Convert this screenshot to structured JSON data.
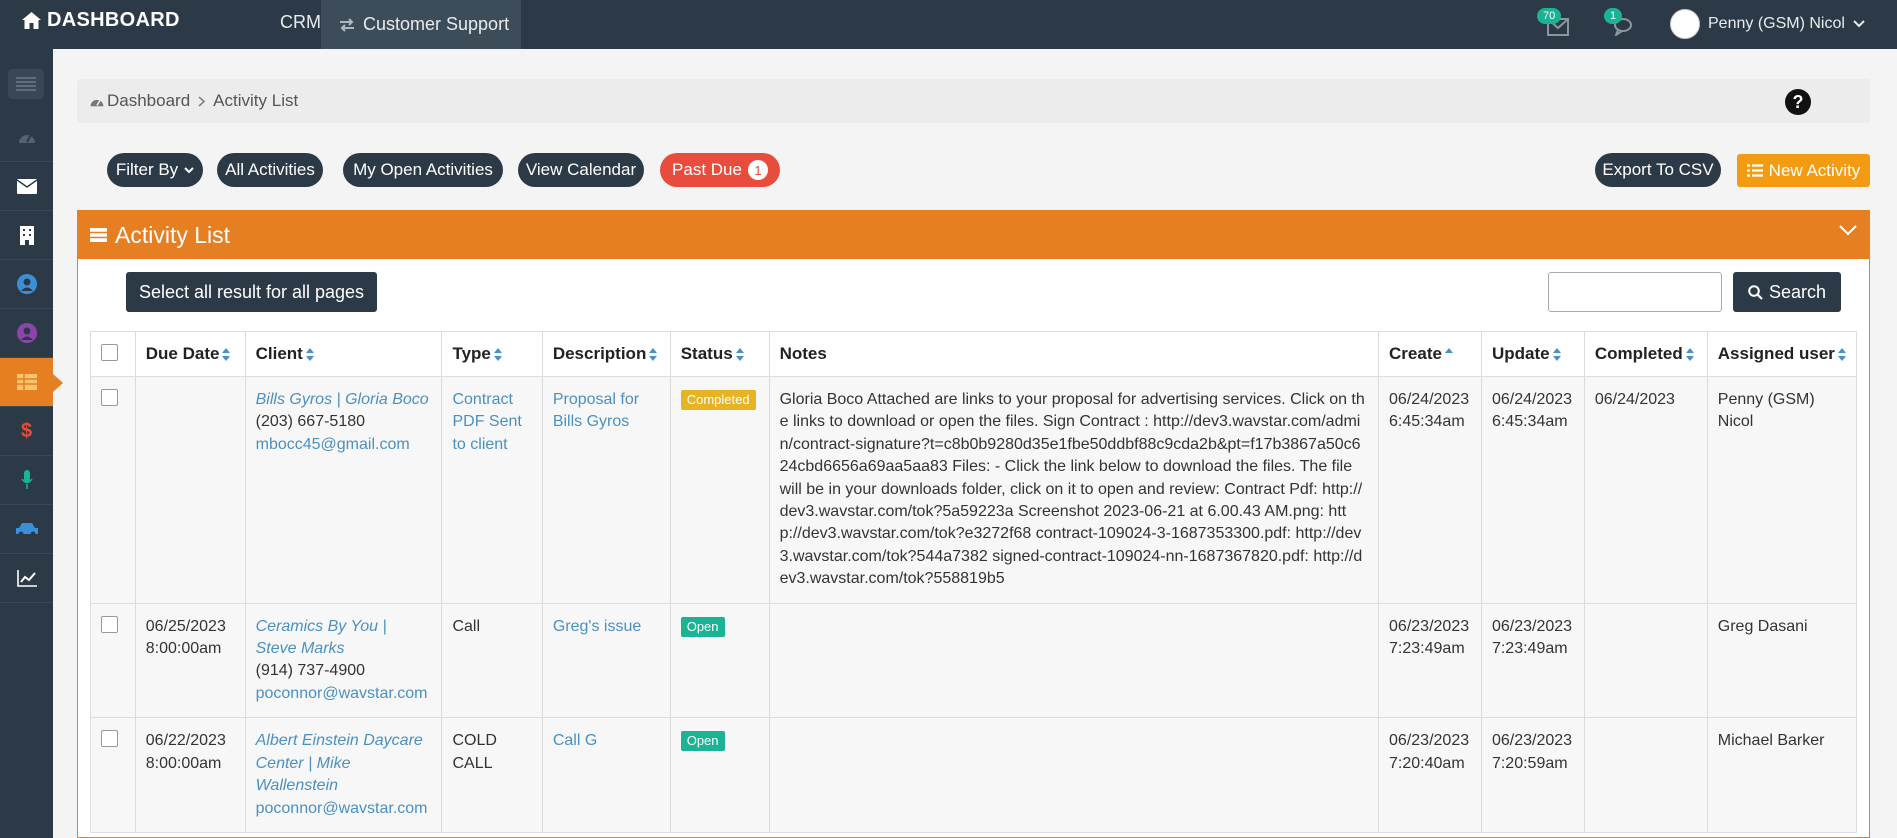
{
  "topbar": {
    "brand": "DASHBOARD",
    "nav_crm": "CRM",
    "nav_customer_support": "Customer Support",
    "mail_count": "70",
    "chat_count": "1",
    "user_name": "Penny (GSM) Nicol"
  },
  "breadcrumb": {
    "home": "Dashboard",
    "current": "Activity List"
  },
  "help_label": "?",
  "filters": {
    "filter_by": "Filter By",
    "all_activities": "All Activities",
    "my_open_activities": "My Open Activities",
    "view_calendar": "View Calendar",
    "past_due": "Past Due",
    "past_due_count": "1"
  },
  "actions": {
    "export_csv": "Export To CSV",
    "new_activity": "New Activity"
  },
  "panel": {
    "title": "Activity List",
    "select_all": "Select all result for all pages",
    "search_value": "",
    "search_button": "Search"
  },
  "table": {
    "headers": {
      "due_date": "Due Date",
      "client": "Client",
      "type": "Type",
      "description": "Description",
      "status": "Status",
      "notes": "Notes",
      "create": "Create",
      "update": "Update",
      "completed": "Completed",
      "assigned_user": "Assigned user"
    },
    "rows": [
      {
        "due_date": "",
        "due_time": "",
        "client_name": "Bills Gyros | Gloria Boco",
        "client_phone": "(203) 667-5180",
        "client_email": "mbocc45@gmail.com",
        "type": "Contract PDF Sent to client",
        "description": "Proposal for Bills Gyros",
        "status": "Completed",
        "notes": "Gloria Boco Attached are links to your proposal for advertising services. Click on the links to download or open the files. Sign Contract : http://dev3.wavstar.com/admin/contract-signature?t=c8b0b9280d35e1fbe50ddbf88c9cda2b&pt=f17b3867a50c624cbd6656a69aa5aa83 Files: - Click the link below to download the files. The file will be in your downloads folder, click on it to open and review: Contract Pdf: http://dev3.wavstar.com/tok?5a59223a Screenshot 2023-06-21 at 6.00.43 AM.png: http://dev3.wavstar.com/tok?e3272f68 contract-109024-3-1687353300.pdf: http://dev3.wavstar.com/tok?544a7382 signed-contract-109024-nn-1687367820.pdf: http://dev3.wavstar.com/tok?558819b5",
        "create_date": "06/24/2023",
        "create_time": "6:45:34am",
        "update_date": "06/24/2023",
        "update_time": "6:45:34am",
        "completed": "06/24/2023",
        "assigned_user": "Penny (GSM) Nicol"
      },
      {
        "due_date": "06/25/2023",
        "due_time": "8:00:00am",
        "client_name": "Ceramics By You | Steve Marks",
        "client_phone": "(914) 737-4900",
        "client_email": "poconnor@wavstar.com",
        "type": "Call",
        "description": "Greg's issue",
        "status": "Open",
        "notes": "",
        "create_date": "06/23/2023",
        "create_time": "7:23:49am",
        "update_date": "06/23/2023",
        "update_time": "7:23:49am",
        "completed": "",
        "assigned_user": "Greg Dasani"
      },
      {
        "due_date": "06/22/2023",
        "due_time": "8:00:00am",
        "client_name": "Albert Einstein Daycare Center | Mike Wallenstein",
        "client_phone": "",
        "client_email": "poconnor@wavstar.com",
        "type": "COLD CALL",
        "description": "Call G",
        "status": "Open",
        "notes": "",
        "create_date": "06/23/2023",
        "create_time": "7:20:40am",
        "update_date": "06/23/2023",
        "update_time": "7:20:59am",
        "completed": "",
        "assigned_user": "Michael Barker"
      }
    ]
  },
  "colors": {
    "nav_dark": "#2c3a47",
    "accent_orange": "#e67e22",
    "past_due_red": "#e74c3c",
    "status_completed": "#e6b422",
    "status_open": "#1ab394",
    "link_blue": "#4a90c2"
  }
}
